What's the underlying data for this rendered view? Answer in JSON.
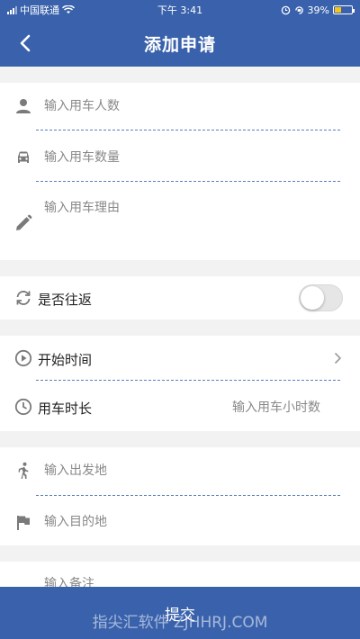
{
  "status_bar": {
    "carrier": "中国联通",
    "time": "下午 3:41",
    "battery": "39%"
  },
  "header": {
    "title": "添加申请"
  },
  "form": {
    "people_placeholder": "输入用车人数",
    "vehicles_placeholder": "输入用车数量",
    "reason_placeholder": "输入用车理由",
    "round_trip_label": "是否往返",
    "round_trip_on": false,
    "start_time_label": "开始时间",
    "duration_label": "用车时长",
    "duration_placeholder": "输入用车小时数",
    "departure_placeholder": "输入出发地",
    "destination_placeholder": "输入目的地",
    "notes_placeholder": "输入备注"
  },
  "footer": {
    "submit_label": "提交"
  },
  "watermark": "指尖汇软件 ZJHHRJ.COM",
  "colors": {
    "primary": "#3a62ac",
    "dash": "#5a7fbf"
  }
}
